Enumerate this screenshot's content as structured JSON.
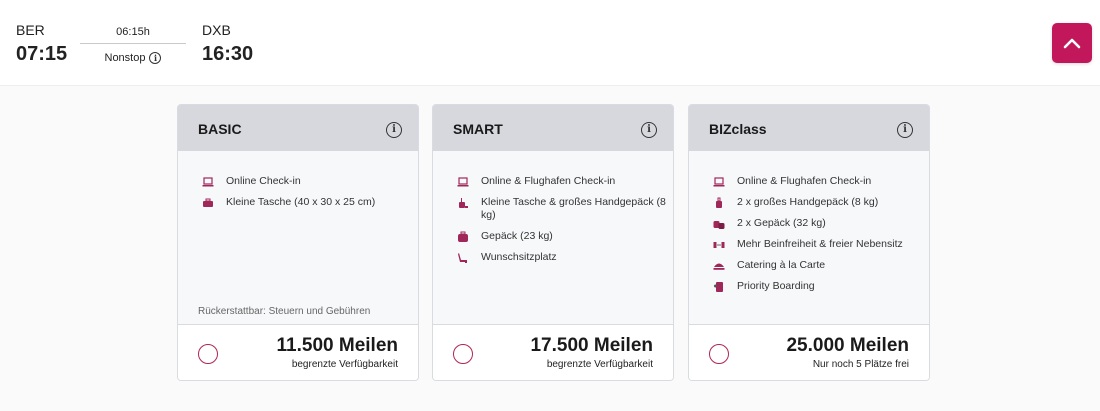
{
  "flight": {
    "origin": "BER",
    "departure_time": "07:15",
    "duration": "06:15h",
    "stops": "Nonstop",
    "destination": "DXB",
    "arrival_time": "16:30",
    "accent_color": "#c2185b"
  },
  "fares": [
    {
      "name": "BASIC",
      "features": [
        {
          "icon": "laptop-icon",
          "text": "Online Check-in"
        },
        {
          "icon": "small-bag-icon",
          "text": "Kleine Tasche (40 x 30 x 25 cm)"
        }
      ],
      "note": "Rückerstattbar: Steuern und Gebühren",
      "miles": "11.500 Meilen",
      "availability": "begrenzte Verfügbarkeit"
    },
    {
      "name": "SMART",
      "features": [
        {
          "icon": "laptop-icon",
          "text": "Online & Flughafen Check-in"
        },
        {
          "icon": "trolley-bag-icon",
          "text": "Kleine Tasche & großes Handgepäck (8 kg)"
        },
        {
          "icon": "suitcase-icon",
          "text": "Gepäck (23 kg)"
        },
        {
          "icon": "seat-icon",
          "text": "Wunschsitzplatz"
        }
      ],
      "miles": "17.500 Meilen",
      "availability": "begrenzte Verfügbarkeit"
    },
    {
      "name": "BIZclass",
      "features": [
        {
          "icon": "laptop-icon",
          "text": "Online & Flughafen Check-in"
        },
        {
          "icon": "trolley-bag-icon",
          "text": "2 x großes Handgepäck (8 kg)"
        },
        {
          "icon": "suitcases-icon",
          "text": "2 x Gepäck (32 kg)"
        },
        {
          "icon": "legroom-icon",
          "text": "Mehr Beinfreiheit & freier Nebensitz"
        },
        {
          "icon": "catering-icon",
          "text": "Catering à la Carte"
        },
        {
          "icon": "priority-boarding-icon",
          "text": "Priority Boarding"
        }
      ],
      "miles": "25.000 Meilen",
      "availability": "Nur noch 5 Plätze frei"
    }
  ]
}
